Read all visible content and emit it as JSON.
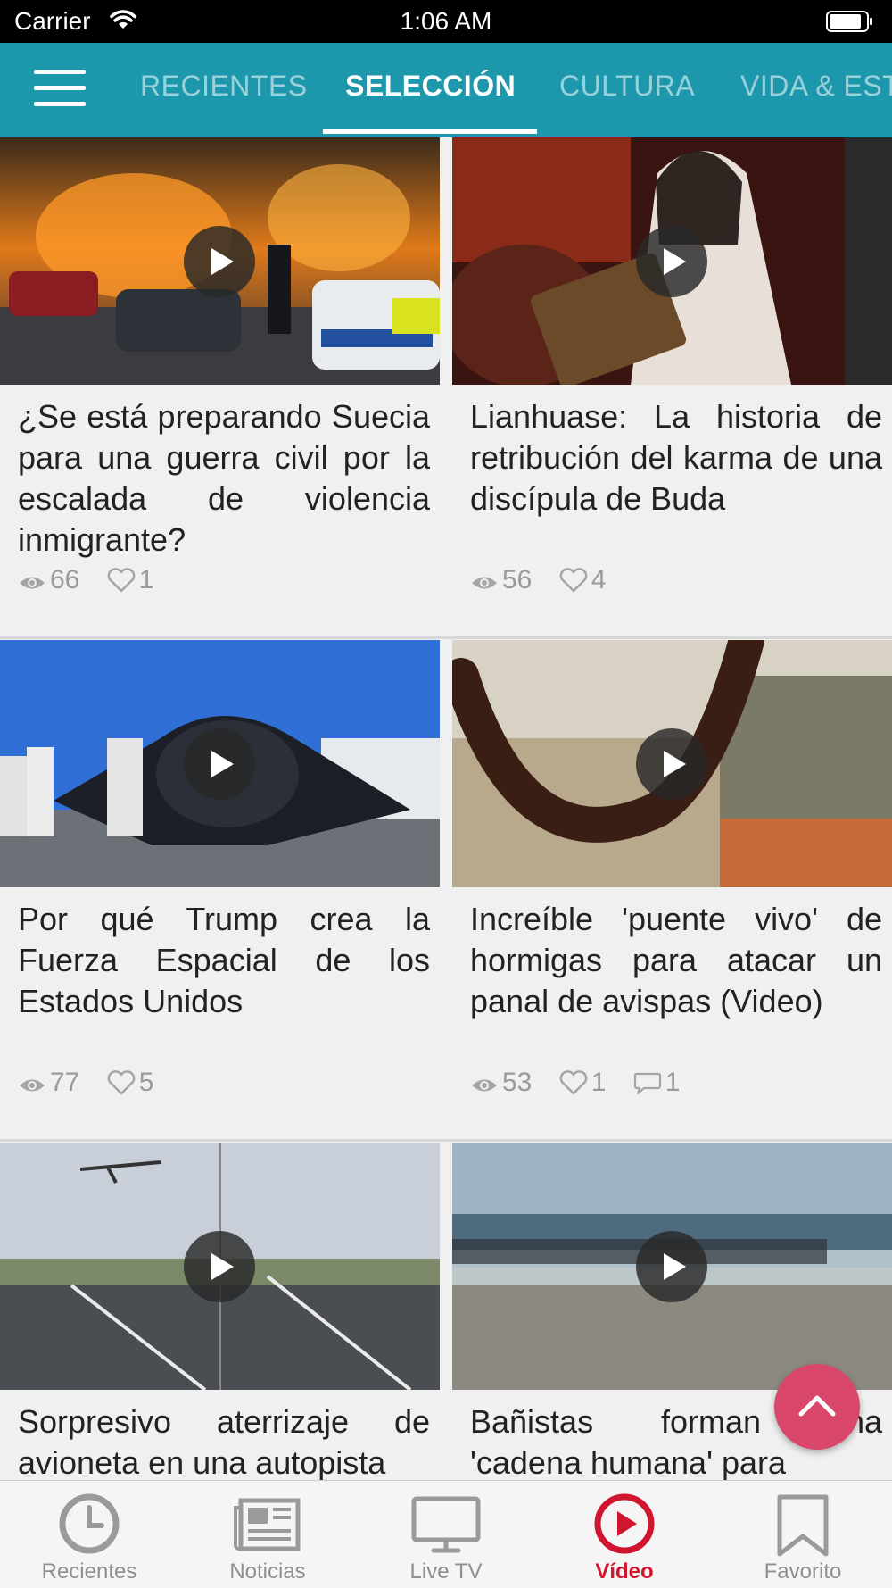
{
  "status_bar": {
    "carrier": "Carrier",
    "time": "1:06 AM"
  },
  "tabs": [
    {
      "label": "RECIENTES",
      "active": false
    },
    {
      "label": "SELECCIÓN",
      "active": true
    },
    {
      "label": "CULTURA",
      "active": false
    },
    {
      "label": "VIDA & EST",
      "active": false
    }
  ],
  "articles": [
    {
      "title": "¿Se está preparando Suecia para una guerra civil por la escalada de violencia inmigrante?",
      "views": "66",
      "likes": "1",
      "comments": ""
    },
    {
      "title": "Lianhuase: La historia de retribución del karma de una discípula de Buda",
      "views": "56",
      "likes": "4",
      "comments": ""
    },
    {
      "title": "Por qué Trump crea la Fuerza Espacial de los Estados Unidos",
      "views": "77",
      "likes": "5",
      "comments": ""
    },
    {
      "title": "Increíble 'puente vivo' de hormigas para atacar un panal de avispas (Video)",
      "views": "53",
      "likes": "1",
      "comments": "1"
    },
    {
      "title": "Sorpresivo aterrizaje de avioneta en una autopista",
      "views": "",
      "likes": "",
      "comments": ""
    },
    {
      "title": "Bañistas forman una 'cadena humana' para",
      "views": "",
      "likes": "",
      "comments": ""
    }
  ],
  "bottom_nav": [
    {
      "label": "Recientes",
      "icon": "clock-icon",
      "active": false
    },
    {
      "label": "Noticias",
      "icon": "newspaper-icon",
      "active": false
    },
    {
      "label": "Live TV",
      "icon": "monitor-icon",
      "active": false
    },
    {
      "label": "Vídeo",
      "icon": "play-circle-icon",
      "active": true
    },
    {
      "label": "Favorito",
      "icon": "bookmark-icon",
      "active": false
    }
  ],
  "colors": {
    "header": "#1d97ab",
    "accent": "#d0152f",
    "fab": "#d9486a"
  }
}
